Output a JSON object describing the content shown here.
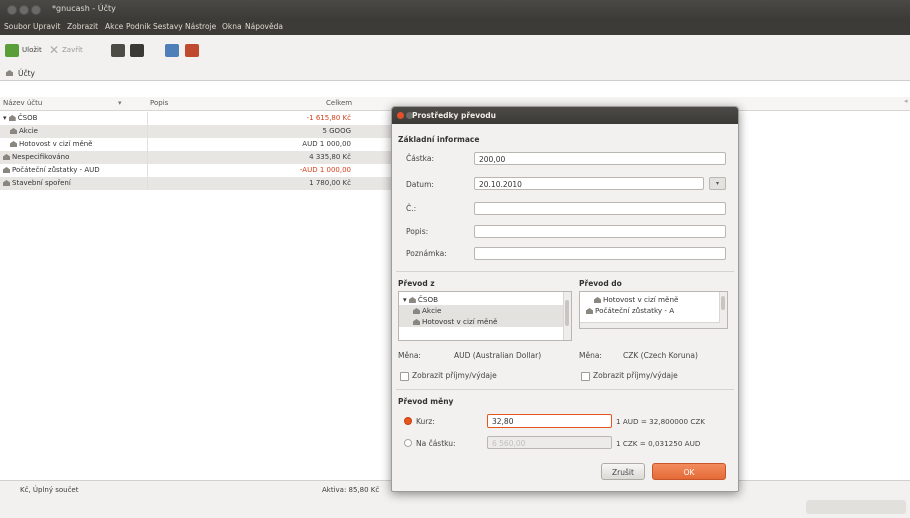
{
  "window": {
    "title": "*gnucash - Účty"
  },
  "menu": [
    "Soubor",
    "Upravit",
    "Zobrazit",
    "Akce",
    "Podnik",
    "Sestavy",
    "Nástroje",
    "Okna",
    "Nápověda"
  ],
  "toolbar": {
    "save_label": "Uložit",
    "close_label": "Zavřít"
  },
  "tab": {
    "label": "Účty"
  },
  "accounts": {
    "headers": {
      "name": "Název účtu",
      "description": "Popis",
      "total": "Celkem"
    },
    "rows": [
      {
        "name": "ČSOB",
        "total": "-1 615,80 Kč",
        "negative": true
      },
      {
        "name": "Akcie",
        "total": "5 GOOG",
        "negative": false
      },
      {
        "name": "Hotovost v cizí měně",
        "total": "AUD 1 000,00",
        "negative": false
      },
      {
        "name": "Nespecifikováno",
        "total": "4 335,80 Kč",
        "negative": false
      },
      {
        "name": "Počáteční zůstatky - AUD",
        "total": "-AUD 1 000,00",
        "negative": true
      },
      {
        "name": "Stavební spoření",
        "total": "1 780,00 Kč",
        "negative": false
      }
    ]
  },
  "status": {
    "left": "Kč, Úplný součet",
    "assets": "Aktiva: 85,80 Kč"
  },
  "dialog": {
    "title": "Prostředky převodu",
    "basic_info_heading": "Základní informace",
    "amount_label": "Částka:",
    "amount_value": "200,00",
    "date_label": "Datum:",
    "date_value": "20.10.2010",
    "num_label": "Č.:",
    "description_label": "Popis:",
    "memo_label": "Poznámka:",
    "from_heading": "Převod z",
    "from_tree": [
      "ČSOB",
      "Akcie",
      "Hotovost v cizí měně"
    ],
    "from_currency_label": "Měna:",
    "from_currency_value": "AUD (Australian Dollar)",
    "from_show_income": "Zobrazit příjmy/výdaje",
    "to_heading": "Převod do",
    "to_tree": [
      "Hotovost v cizí měně",
      "Počáteční zůstatky - A"
    ],
    "to_currency_label": "Měna:",
    "to_currency_value": "CZK (Czech Koruna)",
    "to_show_income": "Zobrazit příjmy/výdaje",
    "exchange_heading": "Převod měny",
    "rate_label": "Kurz:",
    "rate_value": "32,80",
    "rate_text": "1 AUD = 32,800000 CZK",
    "to_amount_label": "Na částku:",
    "to_amount_value": "6 560,00",
    "inverse_rate_text": "1 CZK = 0,031250 AUD",
    "cancel_label": "Zrušit",
    "ok_label": "OK",
    "accent_color": "#e9541e"
  }
}
